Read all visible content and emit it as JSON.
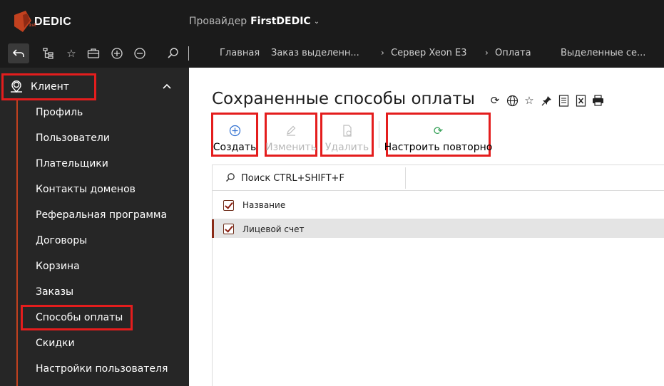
{
  "header": {
    "logo_text": "DEDIC",
    "logo_sub": "1st",
    "provider_label": "Провайдер",
    "provider_name": "FirstDEDIC",
    "provider_caret": "⌄"
  },
  "toolbar": {
    "icons": [
      "back-arrow-icon",
      "tree-icon",
      "star-icon",
      "briefcase-icon",
      "plus-circle-icon",
      "minus-circle-icon",
      "search-icon"
    ]
  },
  "breadcrumbs": [
    {
      "label": "Главная"
    },
    {
      "label": "Заказ выделенн..."
    },
    {
      "label": "Сервер Xeon E3"
    },
    {
      "label": "Оплата"
    },
    {
      "label": "Выделенные се..."
    }
  ],
  "sidebar": {
    "section_label": "Клиент",
    "items": [
      {
        "label": "Профиль"
      },
      {
        "label": "Пользователи"
      },
      {
        "label": "Плательщики"
      },
      {
        "label": "Контакты доменов"
      },
      {
        "label": "Реферальная программа"
      },
      {
        "label": "Договоры"
      },
      {
        "label": "Корзина"
      },
      {
        "label": "Заказы"
      },
      {
        "label": "Способы оплаты"
      },
      {
        "label": "Скидки"
      },
      {
        "label": "Настройки пользователя"
      }
    ],
    "active_item": "Способы оплаты"
  },
  "main": {
    "title": "Сохраненные способы оплаты",
    "title_icons": [
      "refresh-icon",
      "globe-icon",
      "star-icon",
      "pin-icon",
      "export-icon",
      "excel-icon",
      "print-icon"
    ],
    "actions": [
      {
        "label": "Создать",
        "enabled": true
      },
      {
        "label": "Изменить",
        "enabled": false
      },
      {
        "label": "Удалить",
        "enabled": false
      },
      {
        "label": "Настроить повторно",
        "enabled": true
      }
    ],
    "search": {
      "placeholder": "Поиск CTRL+SHIFT+F",
      "value": ""
    },
    "table": {
      "columns": [
        "Название"
      ],
      "rows": [
        [
          "Лицевой счет"
        ]
      ]
    }
  },
  "colors": {
    "accent": "#c2411f",
    "highlight_border": "#e41d1d",
    "sidebar_bg": "#262626",
    "header_bg": "#1b1b1b",
    "refresh_green": "#3aa35b",
    "create_blue": "#2f6fd0"
  }
}
